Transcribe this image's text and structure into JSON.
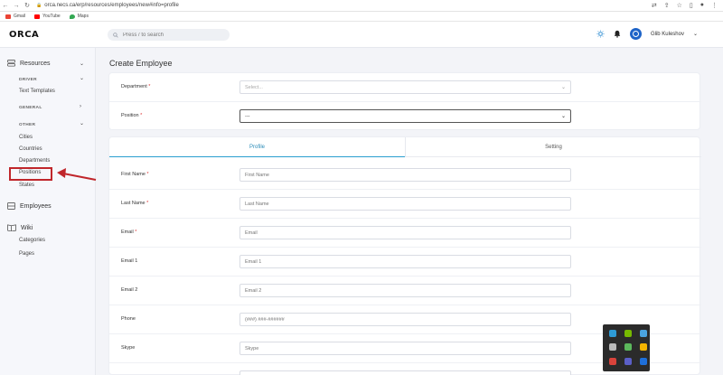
{
  "browser": {
    "url": "orca.necs.ca/erp/resources/employees/new#info=profile",
    "bookmarks": [
      "Gmail",
      "YouTube",
      "Maps"
    ]
  },
  "header": {
    "logo": "ORCA",
    "search_placeholder": "Press / to search",
    "user_name": "Glib Kuleshov"
  },
  "sidebar": {
    "resources": "Resources",
    "driver": "DRIVER",
    "text_templates": "Text Templates",
    "general": "GENERAL",
    "other": "OTHER",
    "other_items": [
      "Cities",
      "Countries",
      "Departments",
      "Positions",
      "States"
    ],
    "employees": "Employees",
    "wiki": "Wiki",
    "wiki_items": [
      "Categories",
      "Pages"
    ]
  },
  "main": {
    "title": "Create Employee",
    "department": {
      "label": "Department",
      "placeholder": "Select..."
    },
    "position": {
      "label": "Position",
      "value": "---"
    },
    "tabs": [
      "Profile",
      "Setting"
    ],
    "fields": [
      {
        "label": "First Name",
        "required": true,
        "placeholder": "First Name"
      },
      {
        "label": "Last Name",
        "required": true,
        "placeholder": "Last Name"
      },
      {
        "label": "Email",
        "required": true,
        "placeholder": "Email"
      },
      {
        "label": "Email 1",
        "required": false,
        "placeholder": "Email 1"
      },
      {
        "label": "Email 2",
        "required": false,
        "placeholder": "Email 2"
      },
      {
        "label": "Phone",
        "required": false,
        "placeholder": "(###) ###-######"
      },
      {
        "label": "Skype",
        "required": false,
        "placeholder": "Skype"
      }
    ]
  },
  "colors": {
    "accent": "#2a9fd0",
    "highlight": "#c0262b",
    "avatar": "#1e64c8"
  }
}
